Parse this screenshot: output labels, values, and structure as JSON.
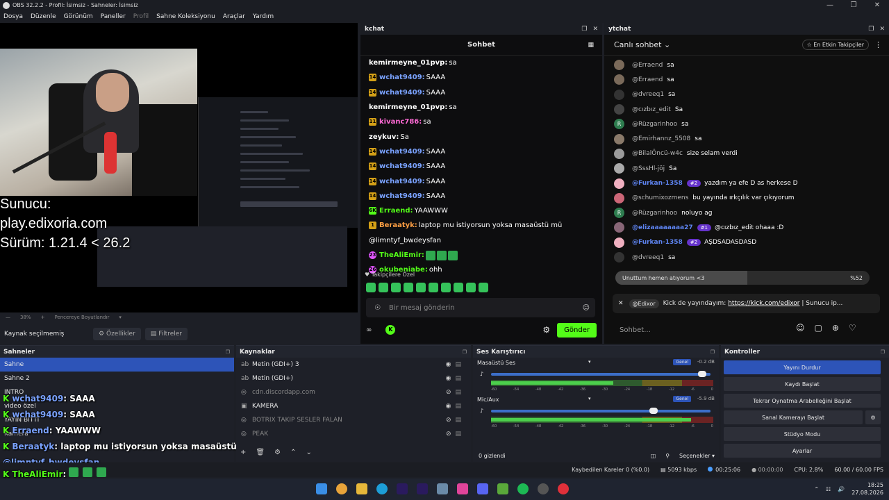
{
  "window": {
    "title": "OBS 32.2.2 - Profil: İsimsiz - Sahneler: İsimsiz"
  },
  "menu": [
    "Dosya",
    "Düzenle",
    "Görünüm",
    "Paneller",
    "Profil",
    "Sahne Koleksiyonu",
    "Araçlar",
    "Yardım"
  ],
  "preview": {
    "overlay": {
      "line1": "Sunucu:",
      "line2": "play.edixoria.com",
      "line3": "Sürüm: 1.21.4 < 26.2"
    },
    "zoom": "38%",
    "fit_label": "Pencereye Boyutlandır",
    "no_source": "Kaynak seçilmemiş",
    "props_btn": "Özellikler",
    "filters_btn": "Filtreler"
  },
  "kchat": {
    "dock_title": "kchat",
    "header": "Sohbet",
    "messages": [
      {
        "badge": "",
        "user": "kemirmeyne_01pvp:",
        "text": "sa",
        "ucolor": "#ffffff"
      },
      {
        "badge": "14",
        "user": "wchat9409:",
        "text": "SAAA",
        "ucolor": "#7aa2ff"
      },
      {
        "badge": "14",
        "user": "wchat9409:",
        "text": "SAAA",
        "ucolor": "#7aa2ff"
      },
      {
        "badge": "",
        "user": "kemirmeyne_01pvp:",
        "text": "sa",
        "ucolor": "#ffffff"
      },
      {
        "badge": "11",
        "user": "kivanc786:",
        "text": "sa",
        "ucolor": "#ff6ad5"
      },
      {
        "badge": "",
        "user": "zeykuv:",
        "text": "Sa",
        "ucolor": "#ffffff"
      },
      {
        "badge": "14",
        "user": "wchat9409:",
        "text": "SAAA",
        "ucolor": "#7aa2ff"
      },
      {
        "badge": "14",
        "user": "wchat9409:",
        "text": "SAAA",
        "ucolor": "#7aa2ff"
      },
      {
        "badge": "14",
        "user": "wchat9409:",
        "text": "SAAA",
        "ucolor": "#7aa2ff"
      },
      {
        "badge": "14",
        "user": "wchat9409:",
        "text": "SAAA",
        "ucolor": "#7aa2ff"
      },
      {
        "badge": "6K",
        "user": "Erraend:",
        "text": "YAAWWW",
        "ucolor": "#53fc18"
      },
      {
        "badge": "1",
        "user": "Beraatyk:",
        "text": "laptop mu istiyorsun yoksa masaüstü mü",
        "ucolor": "#ff9f43"
      },
      {
        "badge": "",
        "user": "",
        "text": "@limntyf_bwdeysfan",
        "ucolor": "#ffffff"
      },
      {
        "badge": "23",
        "user": "TheAliEmir:",
        "text": "",
        "ucolor": "#53fc18"
      },
      {
        "badge": "26",
        "user": "okubeniabe:",
        "text": "ohh",
        "ucolor": "#53fc18"
      }
    ],
    "followers_only": "Takipçilere Özel",
    "input_placeholder": "Bir mesaj gönderin",
    "send_label": "Gönder"
  },
  "ytchat": {
    "dock_title": "ytchat",
    "live_chat": "Canlı sohbet",
    "top_followers": "En Etkin Takipçiler",
    "messages": [
      {
        "av": "",
        "user": "@Erraend",
        "text": "sa",
        "badge": "",
        "blue": false,
        "avc": "#7a6a5a"
      },
      {
        "av": "",
        "user": "@Erraend",
        "text": "sa",
        "badge": "",
        "blue": false,
        "avc": "#7a6a5a"
      },
      {
        "av": "",
        "user": "@dvreeq1",
        "text": "sa",
        "badge": "",
        "blue": false,
        "avc": "#333"
      },
      {
        "av": "",
        "user": "@cızbız_edit",
        "text": "Sa",
        "badge": "",
        "blue": false,
        "avc": "#444"
      },
      {
        "av": "R",
        "user": "@Rüzgarinhoo",
        "text": "sa",
        "badge": "",
        "blue": false,
        "avc": "#2e7d4f"
      },
      {
        "av": "",
        "user": "@Emirhannz_5508",
        "text": "sa",
        "badge": "",
        "blue": false,
        "avc": "#8a7a6a"
      },
      {
        "av": "",
        "user": "@BilalÖncü-w4c",
        "text": "size selam verdi",
        "badge": "",
        "blue": false,
        "avc": "#9a9a9a"
      },
      {
        "av": "",
        "user": "@SssHl-jöj",
        "text": "Sa",
        "badge": "",
        "blue": false,
        "avc": "#aaa"
      },
      {
        "av": "",
        "user": "@Furkan-1358",
        "text": "yazdım ya efe D as herkese D",
        "badge": "#2",
        "blue": true,
        "avc": "#f0b0c0"
      },
      {
        "av": "",
        "user": "@schumixozmens",
        "text": "bu yayında ırkçılık var çıkıyorum",
        "badge": "",
        "blue": false,
        "avc": "#cc6677"
      },
      {
        "av": "R",
        "user": "@Rüzgarinhoo",
        "text": "noluyo ag",
        "badge": "",
        "blue": false,
        "avc": "#2e7d4f"
      },
      {
        "av": "",
        "user": "@elizaaaaaaaa27",
        "text": "@cızbız_edit ohaaa :D",
        "badge": "#1",
        "blue": true,
        "avc": "#886677"
      },
      {
        "av": "",
        "user": "@Furkan-1358",
        "text": "AŞDSADASDASD",
        "badge": "#2",
        "blue": true,
        "avc": "#f0b0c0"
      },
      {
        "av": "",
        "user": "@dvreeq1",
        "text": "sa",
        "badge": "",
        "blue": false,
        "avc": "#333"
      }
    ],
    "poll": {
      "question": "Unuttum hemen atıyorum <3",
      "percent": "%52",
      "fraction": 0.52
    },
    "pinned": {
      "user": "@Edixor",
      "text": "Kick de yayındayım:",
      "link": "https://kick.com/edixor",
      "rest": "| Sunucu ip..."
    },
    "input_placeholder": "Sohbet..."
  },
  "scenes": {
    "title": "Sahneler",
    "items": [
      "Sahne",
      "Sahne 2",
      "INTRO",
      "video özel",
      "YAYIN BİTTİ",
      "Kamera"
    ],
    "selected": 0,
    "overlay": [
      {
        "user": "wchat9409",
        "text": ": SAAA"
      },
      {
        "user": "wchat9409",
        "text": ": SAAA"
      },
      {
        "user": "Erraend",
        "text": ": YAAWWW"
      },
      {
        "user": "Beraatyk",
        "text": ": laptop mu istiyorsun yoksa masaüstü mü"
      },
      {
        "user": "",
        "text": "@limntyf_bwdeysfan"
      }
    ]
  },
  "sources": {
    "title": "Kaynaklar",
    "items": [
      {
        "name": "Metin (GDI+) 3",
        "icon": "ab",
        "visible": true
      },
      {
        "name": "Metin (GDI+)",
        "icon": "ab",
        "visible": true
      },
      {
        "name": "cdn.discordapp.com",
        "icon": "globe",
        "visible": false
      },
      {
        "name": "KAMERA",
        "icon": "cam",
        "visible": true
      },
      {
        "name": "BOTRIX TAKIP SESLER FALAN",
        "icon": "globe",
        "visible": false
      },
      {
        "name": "PEAK",
        "icon": "globe",
        "visible": false
      }
    ]
  },
  "mixer": {
    "title": "Ses Karıştırıcı",
    "channels": [
      {
        "name": "Masaüstü Ses",
        "tag": "Genel",
        "db": "-0.2 dB",
        "vol": 0.98,
        "level": 0.55
      },
      {
        "name": "Mic/Aux",
        "tag": "Genel",
        "db": "-5.9 dB",
        "vol": 0.75,
        "level": 0.9
      }
    ],
    "ticks": [
      "-60",
      "-54",
      "-48",
      "-42",
      "-36",
      "-30",
      "-24",
      "-18",
      "-12",
      "-6",
      "0"
    ],
    "hidden": "0 gizlendi",
    "options": "Seçenekler"
  },
  "controls": {
    "title": "Kontroller",
    "buttons": [
      "Yayını Durdur",
      "Kaydı Başlat",
      "Tekrar Oynatma Arabelleğini Başlat",
      "Sanal Kamerayı Başlat",
      "Stüdyo Modu",
      "Ayarlar"
    ]
  },
  "status": {
    "dropped": "Kaybedilen Kareler 0 (%0.0)",
    "kbps": "5093 kbps",
    "stream_time": "00:25:06",
    "rec_time": "00:00:00",
    "cpu": "CPU: 2.8%",
    "fps": "60.00 / 60.00 FPS"
  },
  "bottom_overlay": [
    {
      "user": "TheAliEmir",
      "text": ":"
    },
    {
      "user": "okubeniabe",
      "text": ": ohh"
    }
  ],
  "taskbar": {
    "time": "18:25",
    "date": "27.08.2026"
  }
}
